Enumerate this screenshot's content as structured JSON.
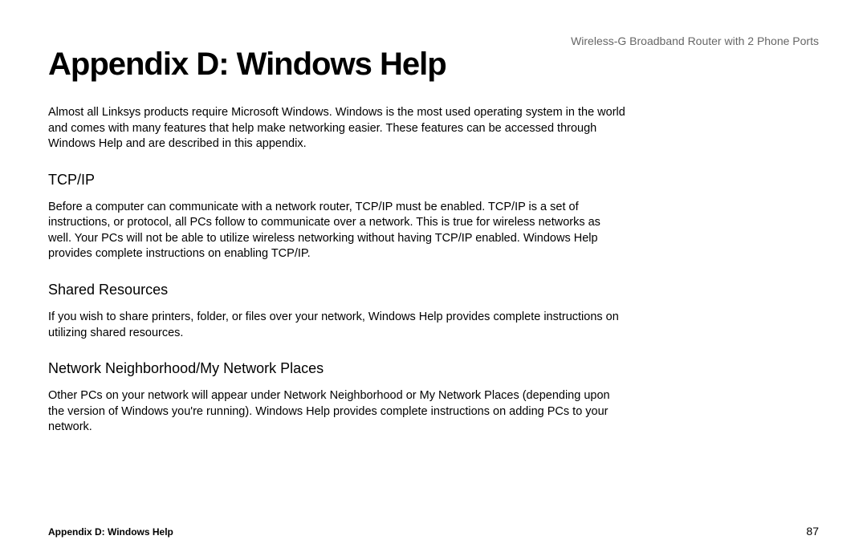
{
  "header": {
    "product_name": "Wireless-G Broadband Router with 2 Phone Ports"
  },
  "main": {
    "title": "Appendix D: Windows Help",
    "intro": "Almost all Linksys products require Microsoft Windows. Windows is the most used operating system in the world and comes with many features that help make networking easier. These features can be accessed through Windows Help and are described in this appendix.",
    "sections": [
      {
        "heading": "TCP/IP",
        "body": "Before a computer can communicate with a network router, TCP/IP must be enabled. TCP/IP is a set of instructions, or protocol, all PCs follow to communicate over a network. This is true for wireless networks as well. Your PCs will not be able to utilize wireless networking without having TCP/IP enabled. Windows Help provides complete instructions on enabling TCP/IP."
      },
      {
        "heading": "Shared Resources",
        "body": "If you wish to share printers, folder, or files over your network, Windows Help provides complete instructions on utilizing shared resources."
      },
      {
        "heading": "Network Neighborhood/My Network Places",
        "body": "Other PCs on your network will appear under Network Neighborhood or My Network Places (depending upon the version of Windows you're running). Windows Help provides complete instructions on adding PCs to your network."
      }
    ]
  },
  "footer": {
    "left": "Appendix D: Windows Help",
    "page_number": "87"
  }
}
